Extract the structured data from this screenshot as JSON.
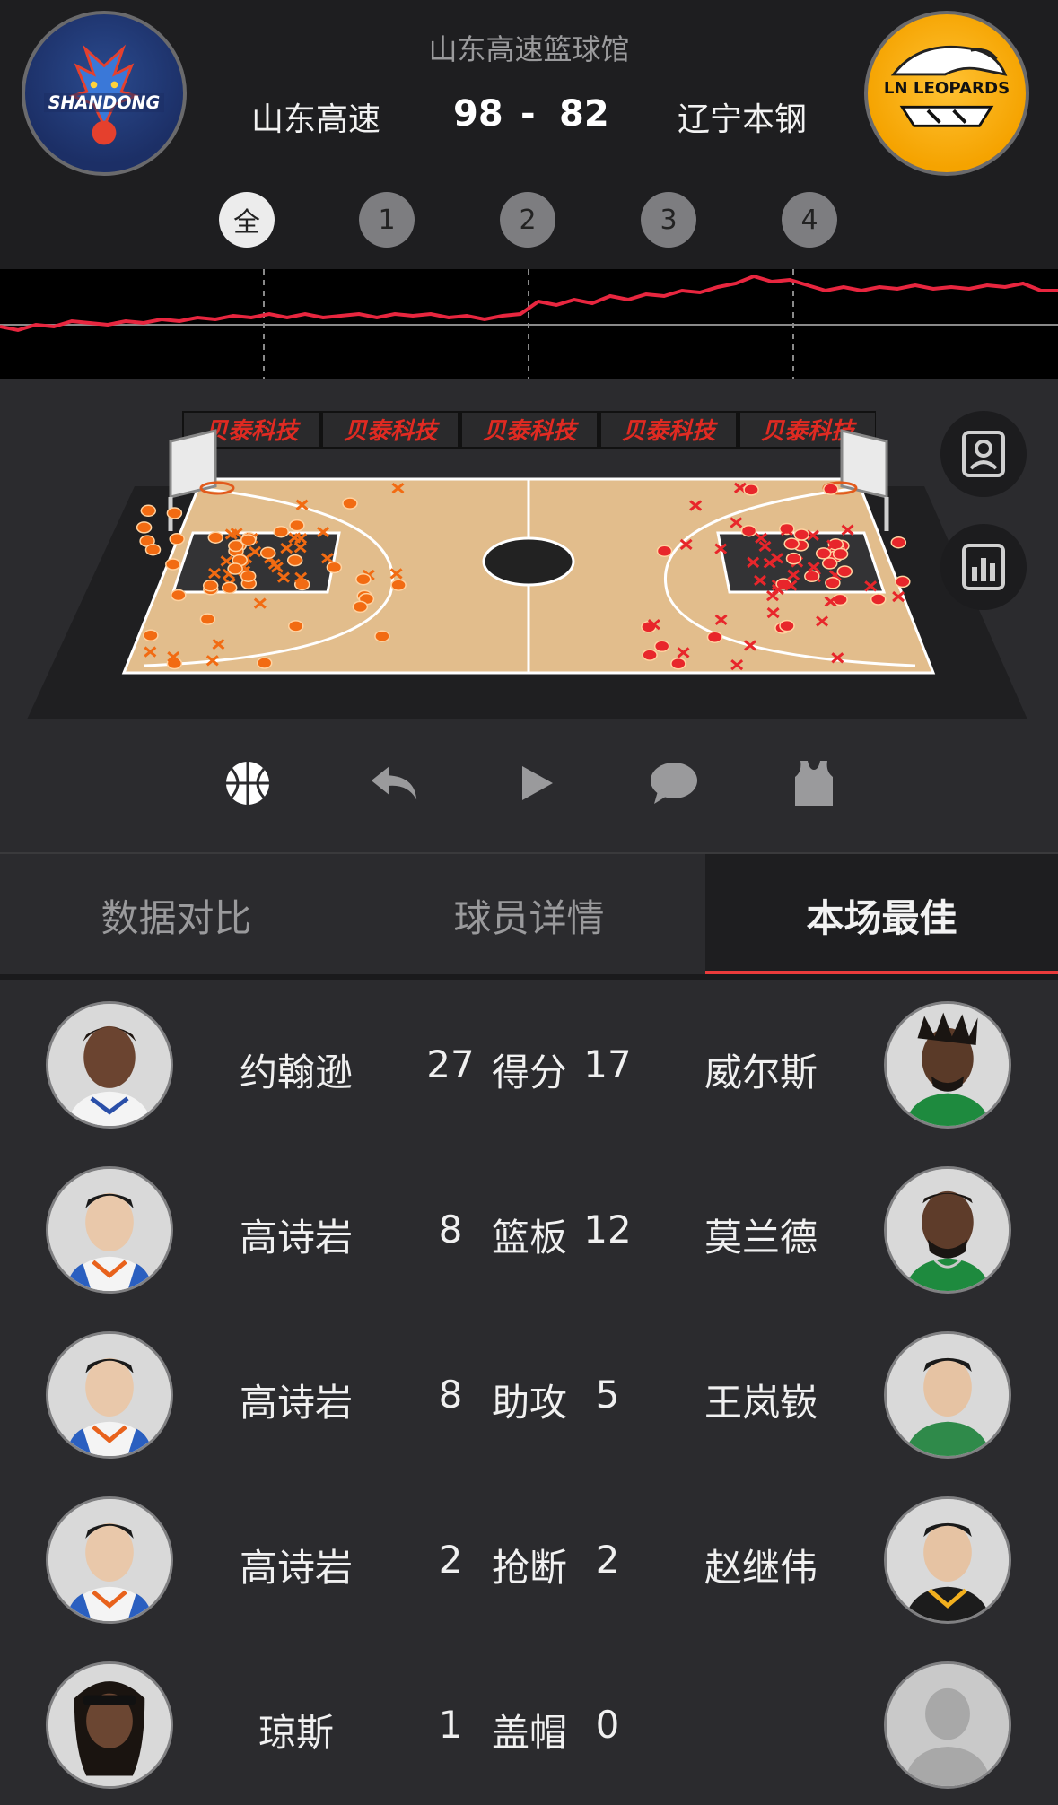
{
  "header": {
    "venue": "山东高速篮球馆",
    "home_team": "山东高速",
    "away_team": "辽宁本钢",
    "home_score": "98",
    "separator": "-",
    "away_score": "82",
    "home_logo_text": "SHANDONG",
    "away_logo_text": "LN LEOPARDS"
  },
  "quarters": [
    "全",
    "1",
    "2",
    "3",
    "4"
  ],
  "quarter_selected": "全",
  "court": {
    "banner_text": [
      "贝泰科技",
      "贝泰科技",
      "贝泰科技",
      "贝泰科技",
      "贝泰科技"
    ]
  },
  "side_buttons": [
    "person-card-icon",
    "bar-chart-icon"
  ],
  "toolbar": [
    "basketball-icon",
    "replay-icon",
    "play-icon",
    "comment-icon",
    "jersey-icon"
  ],
  "tabs": [
    {
      "label": "数据对比",
      "active": false
    },
    {
      "label": "球员详情",
      "active": false
    },
    {
      "label": "本场最佳",
      "active": true
    }
  ],
  "best": [
    {
      "left_name": "约翰逊",
      "left_value": "27",
      "stat": "得分",
      "right_value": "17",
      "right_name": "威尔斯"
    },
    {
      "left_name": "高诗岩",
      "left_value": "8",
      "stat": "篮板",
      "right_value": "12",
      "right_name": "莫兰德"
    },
    {
      "left_name": "高诗岩",
      "left_value": "8",
      "stat": "助攻",
      "right_value": "5",
      "right_name": "王岚嵚"
    },
    {
      "left_name": "高诗岩",
      "left_value": "2",
      "stat": "抢断",
      "right_value": "2",
      "right_name": "赵继伟"
    },
    {
      "left_name": "琼斯",
      "left_value": "1",
      "stat": "盖帽",
      "right_value": "0",
      "right_name": ""
    }
  ],
  "colors": {
    "accent_red": "#ea3b3b",
    "home_shot": "#f26b12",
    "away_shot": "#e8262b",
    "trend_line": "#e8263f"
  }
}
